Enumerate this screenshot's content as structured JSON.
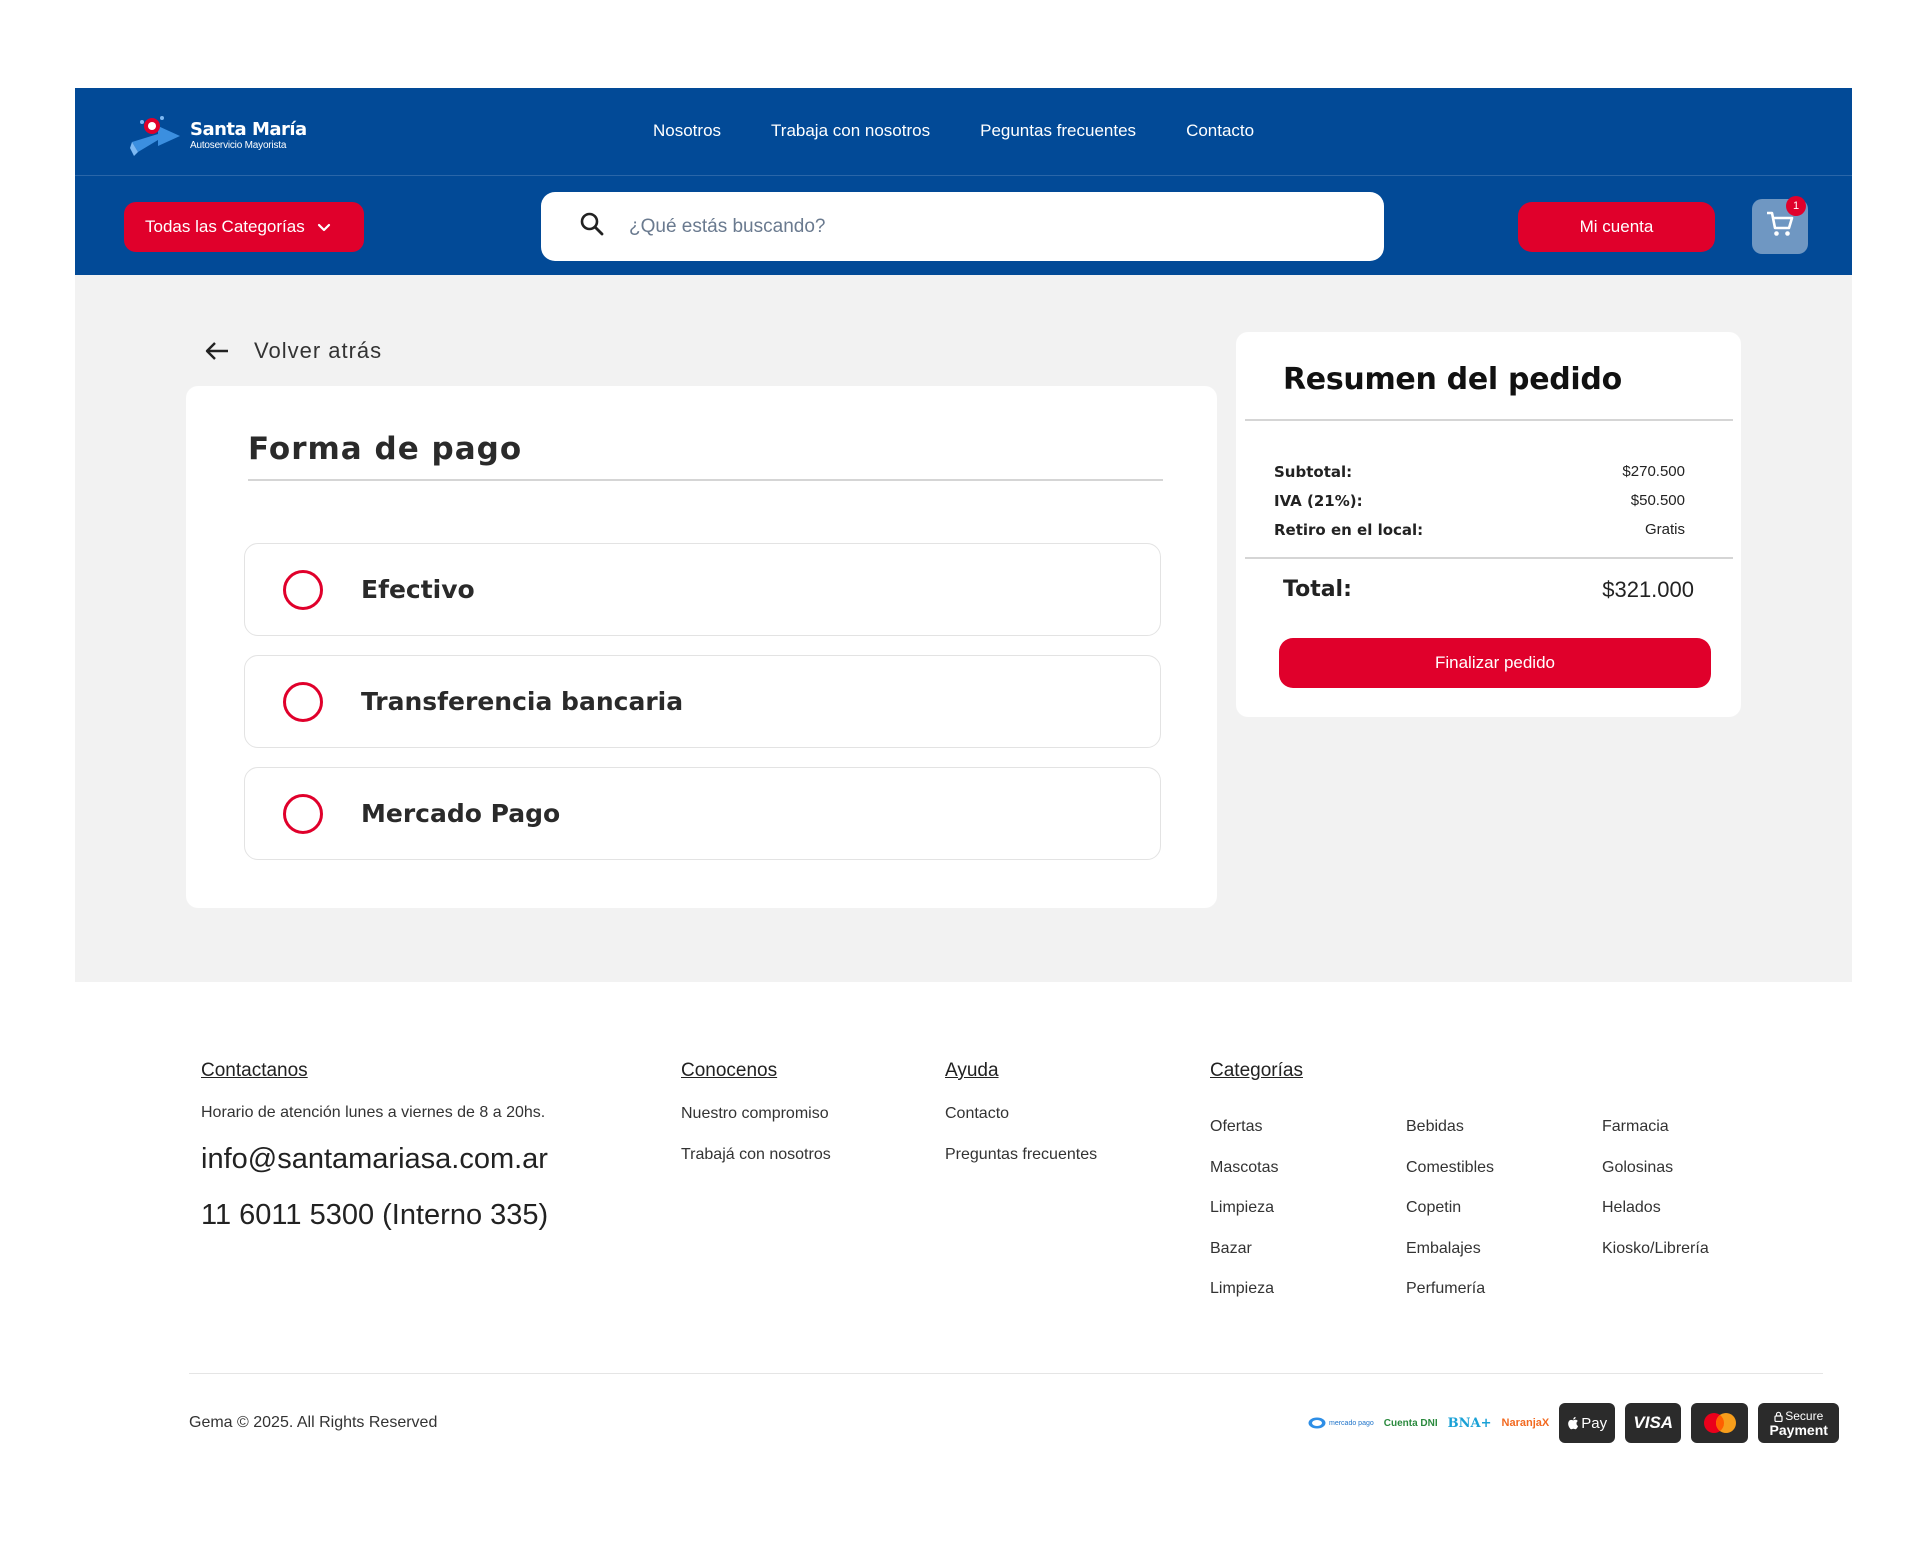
{
  "header": {
    "logo": {
      "name": "Santa María",
      "subtitle": "Autoservicio Mayorista"
    },
    "nav": [
      "Nosotros",
      "Trabaja con nosotros",
      "Peguntas frecuentes",
      "Contacto"
    ],
    "categories_button": "Todas las Categorías",
    "search_placeholder": "¿Qué estás buscando?",
    "account_button": "Mi cuenta",
    "cart_count": "1"
  },
  "main": {
    "back_label": "Volver atrás",
    "payment": {
      "title": "Forma de pago",
      "options": [
        "Efectivo",
        "Transferencia bancaria",
        "Mercado Pago"
      ]
    },
    "summary": {
      "title": "Resumen del pedido",
      "rows": [
        {
          "label": "Subtotal:",
          "value": "$270.500"
        },
        {
          "label": "IVA (21%):",
          "value": "$50.500"
        },
        {
          "label": "Retiro en el local:",
          "value": "Gratis"
        }
      ],
      "total_label": "Total:",
      "total_value": "$321.000",
      "finish_button": "Finalizar pedido"
    }
  },
  "footer": {
    "contact": {
      "heading": "Contactanos",
      "hours": "Horario de atención lunes a viernes de 8 a 20hs.",
      "email": "info@santamariasa.com.ar",
      "phone": "11 6011 5300 (Interno 335)"
    },
    "about": {
      "heading": "Conocenos",
      "links": [
        "Nuestro compromiso",
        "Trabajá con nosotros"
      ]
    },
    "help": {
      "heading": "Ayuda",
      "links": [
        "Contacto",
        "Preguntas frecuentes"
      ]
    },
    "categories": {
      "heading": "Categorías",
      "items": [
        "Ofertas",
        "Bebidas",
        "Farmacia",
        "Mascotas",
        "Comestibles",
        "Golosinas",
        "Limpieza",
        "Copetin",
        "Helados",
        "Bazar",
        "Embalajes",
        "Kiosko/Librería",
        "Limpieza",
        "Perfumería"
      ]
    },
    "copyright": "Gema © 2025. All Rights Reserved",
    "payment_logos": {
      "mercadopago": "mercado pago",
      "cuentadni": "Cuenta DNI",
      "bna": "BNA+",
      "naranjax": "NaranjaX",
      "applepay": "Pay",
      "visa": "VISA",
      "secure_top": "Secure",
      "secure_bottom": "Payment"
    },
    "colors": {
      "brand_blue": "#024a97",
      "accent_red": "#e0002b"
    }
  }
}
